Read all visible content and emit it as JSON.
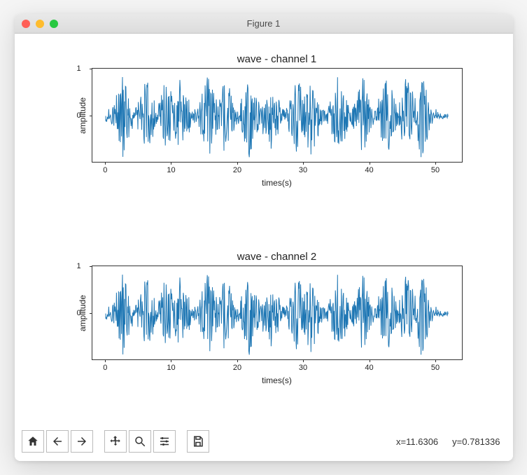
{
  "window": {
    "title": "Figure 1"
  },
  "chart_data": [
    {
      "type": "line",
      "title": "wave - channel 1",
      "xlabel": "times(s)",
      "ylabel": "amplitude",
      "xlim": [
        -2,
        54
      ],
      "ylim": [
        -1,
        1
      ],
      "xticks": [
        0,
        10,
        20,
        30,
        40,
        50
      ],
      "yticks": [
        0,
        1
      ],
      "series": [
        {
          "name": "waveform",
          "color": "#1f77b4",
          "description": "Dense audio waveform oscillating around 0, peak amplitude approx ±1, duration ~52s"
        }
      ]
    },
    {
      "type": "line",
      "title": "wave - channel 2",
      "xlabel": "times(s)",
      "ylabel": "amplitude",
      "xlim": [
        -2,
        54
      ],
      "ylim": [
        -1,
        1
      ],
      "xticks": [
        0,
        10,
        20,
        30,
        40,
        50
      ],
      "yticks": [
        0,
        1
      ],
      "series": [
        {
          "name": "waveform",
          "color": "#1f77b4",
          "description": "Dense audio waveform oscillating around 0, peak amplitude approx ±1, duration ~52s"
        }
      ]
    }
  ],
  "toolbar": {
    "home": "Home",
    "back": "Back",
    "forward": "Forward",
    "pan": "Pan",
    "zoom": "Zoom",
    "configure": "Configure",
    "save": "Save"
  },
  "cursor": {
    "x_label": "x=11.6306",
    "y_label": "y=0.781336"
  }
}
